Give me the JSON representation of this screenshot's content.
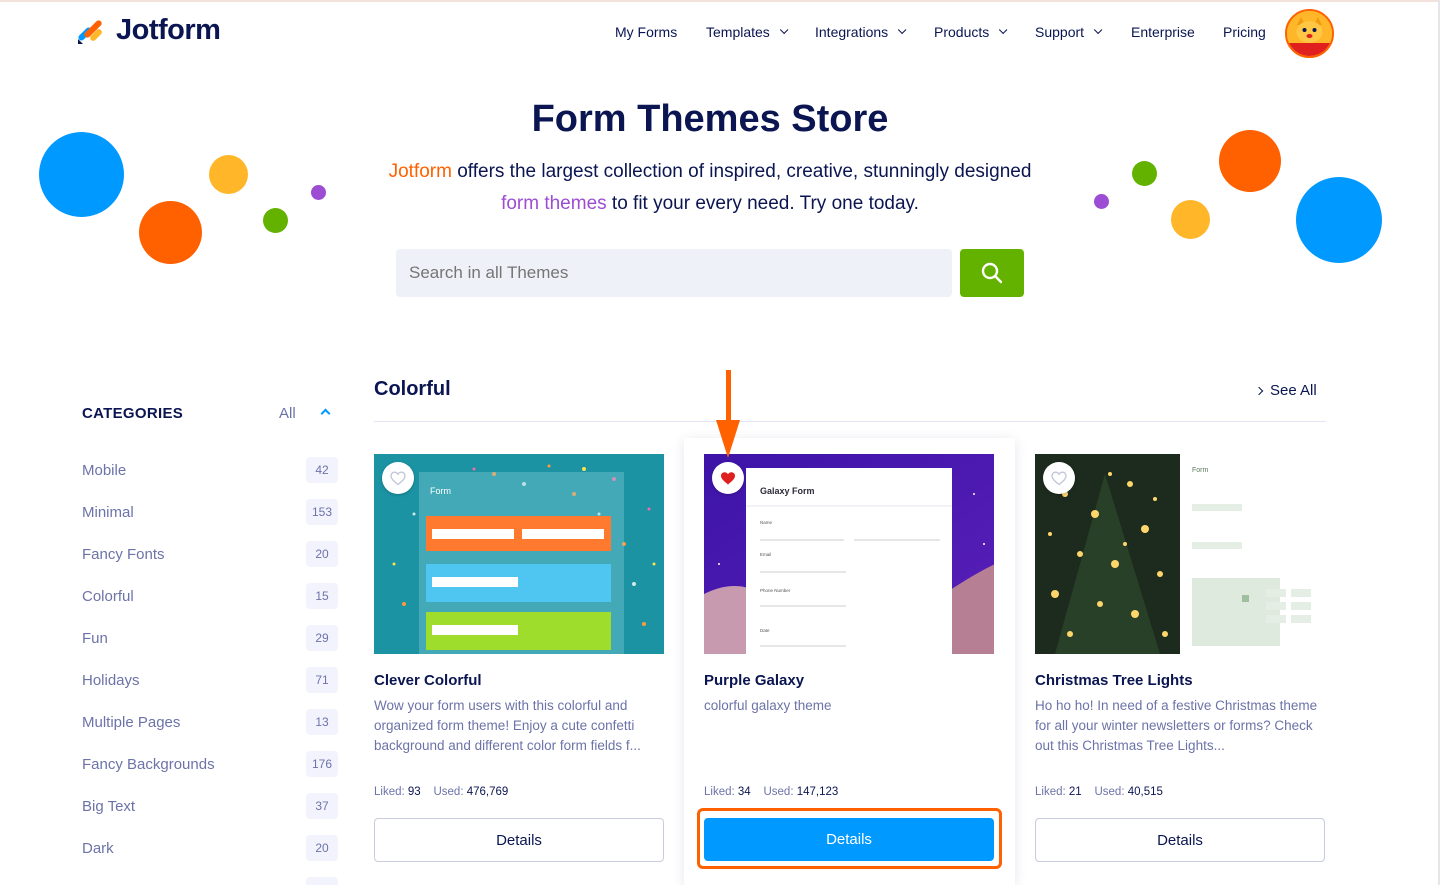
{
  "brand": {
    "name": "Jotform"
  },
  "nav": {
    "items": [
      {
        "label": "My Forms",
        "dropdown": false
      },
      {
        "label": "Templates",
        "dropdown": true
      },
      {
        "label": "Integrations",
        "dropdown": true
      },
      {
        "label": "Products",
        "dropdown": true
      },
      {
        "label": "Support",
        "dropdown": true
      },
      {
        "label": "Enterprise",
        "dropdown": false
      },
      {
        "label": "Pricing",
        "dropdown": false
      }
    ]
  },
  "hero": {
    "title": "Form Themes Store",
    "sub_brand": "Jotform",
    "sub_part1": " offers the largest collection of inspired, creative, stunningly designed ",
    "sub_highlight": "form themes",
    "sub_part2": " to fit your every need. Try one today.",
    "search_placeholder": "Search in all Themes"
  },
  "sidebar": {
    "heading": "CATEGORIES",
    "all_label": "All",
    "categories": [
      {
        "label": "Mobile",
        "count": "42"
      },
      {
        "label": "Minimal",
        "count": "153"
      },
      {
        "label": "Fancy Fonts",
        "count": "20"
      },
      {
        "label": "Colorful",
        "count": "15"
      },
      {
        "label": "Fun",
        "count": "29"
      },
      {
        "label": "Holidays",
        "count": "71"
      },
      {
        "label": "Multiple Pages",
        "count": "13"
      },
      {
        "label": "Fancy Backgrounds",
        "count": "176"
      },
      {
        "label": "Big Text",
        "count": "37"
      },
      {
        "label": "Dark",
        "count": "20"
      }
    ]
  },
  "section": {
    "title": "Colorful",
    "see_all": "See All"
  },
  "cards": [
    {
      "title": "Clever Colorful",
      "desc": "Wow your form users with this colorful and organized form theme! Enjoy a cute confetti background and different color form fields f...",
      "liked_label": "Liked:",
      "liked": "93",
      "used_label": "Used:",
      "used": "476,769",
      "button": "Details",
      "favorited": false,
      "form_label": "Form"
    },
    {
      "title": "Purple Galaxy",
      "desc": "colorful galaxy theme",
      "liked_label": "Liked:",
      "liked": "34",
      "used_label": "Used:",
      "used": "147,123",
      "button": "Details",
      "favorited": true,
      "form_label": "Galaxy Form"
    },
    {
      "title": "Christmas Tree Lights",
      "desc": "Ho ho ho! In need of a festive Christmas theme for all your winter newsletters or forms? Check out this Christmas Tree Lights...",
      "liked_label": "Liked:",
      "liked": "21",
      "used_label": "Used:",
      "used": "40,515",
      "button": "Details",
      "favorited": false,
      "form_label": "Form"
    }
  ],
  "colors": {
    "navy": "#0a1551",
    "orange": "#ff6100",
    "green": "#64b200",
    "blue": "#0099ff",
    "purple": "#9c4dd3",
    "yellow": "#ffb629",
    "heart_red": "#e0201f"
  }
}
